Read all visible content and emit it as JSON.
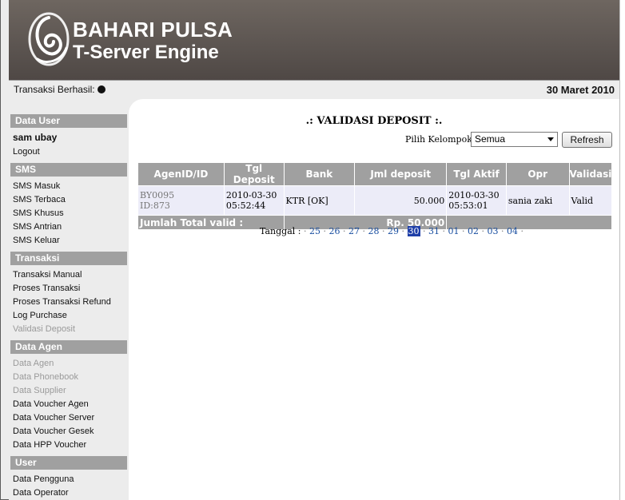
{
  "header": {
    "brand_line1": "BAHARI PULSA",
    "brand_line2": "T-Server Engine"
  },
  "status": {
    "label": "Transaksi Berhasil:",
    "date": "30 Maret 2010"
  },
  "sidebar": {
    "data_user": {
      "title": "Data User",
      "username": "sam ubay",
      "logout": "Logout"
    },
    "sms": {
      "title": "SMS",
      "items": [
        "SMS Masuk",
        "SMS Terbaca",
        "SMS Khusus",
        "SMS Antrian",
        "SMS Keluar"
      ]
    },
    "transaksi": {
      "title": "Transaksi",
      "items": [
        "Transaksi Manual",
        "Proses Transaksi",
        "Proses Transaksi Refund",
        "Log Purchase",
        "Validasi Deposit"
      ]
    },
    "data_agen": {
      "title": "Data Agen",
      "items": [
        "Data Agen",
        "Data Phonebook",
        "Data Supplier",
        "Data Voucher Agen",
        "Data Voucher Server",
        "Data Voucher Gesek",
        "Data HPP Voucher"
      ]
    },
    "user": {
      "title": "User",
      "items": [
        "Data Pengguna",
        "Data Operator"
      ]
    }
  },
  "main": {
    "title": ".: VALIDASI DEPOSIT :.",
    "group_label": "Pilih Kelompok:",
    "group_value": "Semua",
    "refresh_label": "Refresh",
    "table": {
      "headers": [
        "AgenID/ID",
        "Tgl Deposit",
        "Bank",
        "Jml deposit",
        "Tgl Aktif",
        "Opr",
        "Validasi"
      ],
      "rows": [
        {
          "agen_id": "BY0095",
          "id": "ID:873",
          "tgl_deposit_date": "2010-03-30",
          "tgl_deposit_time": "05:52:44",
          "bank": "KTR [OK]",
          "jml": "50.000",
          "tgl_aktif_date": "2010-03-30",
          "tgl_aktif_time": "05:53:01",
          "opr": "sania zaki",
          "validasi": "Valid"
        }
      ],
      "total_label": "Jumlah Total valid :",
      "total_value": "Rp. 50.000"
    },
    "pager": {
      "label": "Tanggal :",
      "pages": [
        "25",
        "26",
        "27",
        "28",
        "29",
        "30",
        "31",
        "01",
        "02",
        "03",
        "04"
      ],
      "current": "30"
    }
  },
  "colors": {
    "header_bg": "#5b5450",
    "section_bg": "#a0a0a0",
    "row_bg": "#ececf8",
    "link": "#1a4fa0",
    "current_page_bg": "#1f3fa8"
  }
}
